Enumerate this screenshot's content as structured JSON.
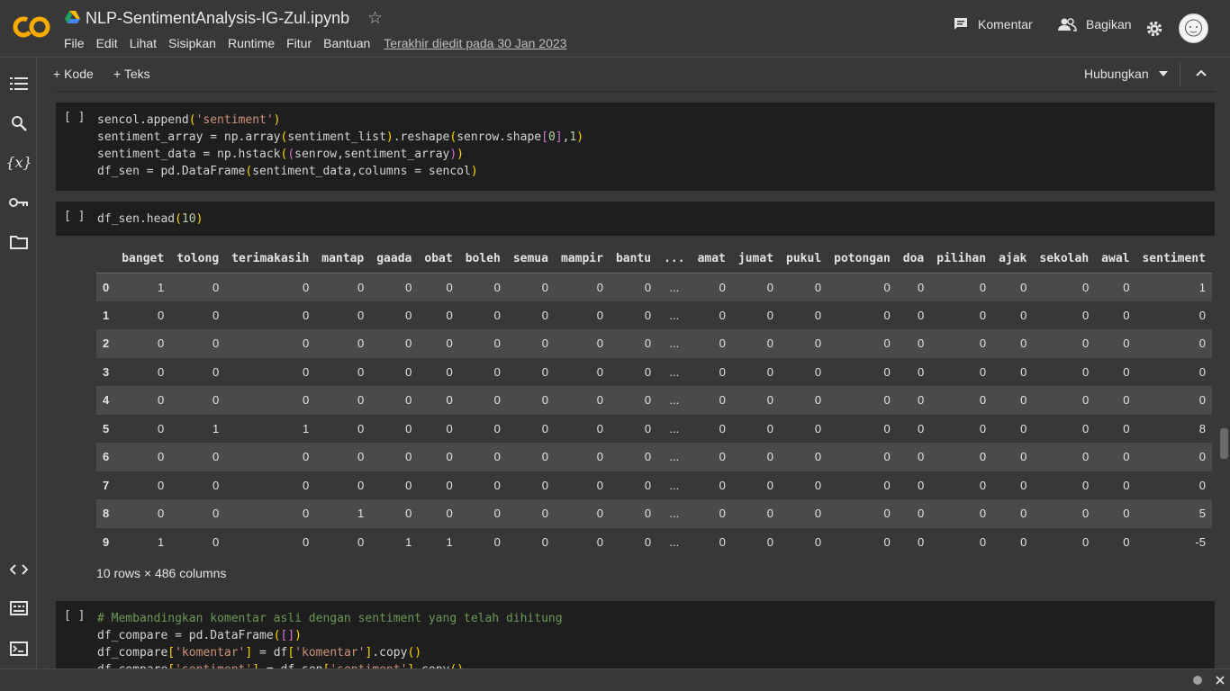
{
  "header": {
    "title": "NLP-SentimentAnalysis-IG-Zul.ipynb",
    "menu": [
      "File",
      "Edit",
      "Lihat",
      "Sisipkan",
      "Runtime",
      "Fitur",
      "Bantuan"
    ],
    "last_edit": "Terakhir diedit pada 30 Jan 2023",
    "comment_label": "Komentar",
    "share_label": "Bagikan"
  },
  "toolbar": {
    "add_code": "+ Kode",
    "add_text": "+ Teks",
    "connect": "Hubungkan"
  },
  "cells": {
    "cell1_bracket": "[ ]",
    "cell2_bracket": "[ ]",
    "cell3_bracket": "[ ]",
    "cell2_code": "df_sen.head(10)"
  },
  "dataframe": {
    "columns": [
      "",
      "banget",
      "tolong",
      "terimakasih",
      "mantap",
      "gaada",
      "obat",
      "boleh",
      "semua",
      "mampir",
      "bantu",
      "...",
      "amat",
      "jumat",
      "pukul",
      "potongan",
      "doa",
      "pilihan",
      "ajak",
      "sekolah",
      "awal",
      "sentiment"
    ],
    "rows": [
      [
        "0",
        "1",
        "0",
        "0",
        "0",
        "0",
        "0",
        "0",
        "0",
        "0",
        "0",
        "...",
        "0",
        "0",
        "0",
        "0",
        "0",
        "0",
        "0",
        "0",
        "0",
        "1"
      ],
      [
        "1",
        "0",
        "0",
        "0",
        "0",
        "0",
        "0",
        "0",
        "0",
        "0",
        "0",
        "...",
        "0",
        "0",
        "0",
        "0",
        "0",
        "0",
        "0",
        "0",
        "0",
        "0"
      ],
      [
        "2",
        "0",
        "0",
        "0",
        "0",
        "0",
        "0",
        "0",
        "0",
        "0",
        "0",
        "...",
        "0",
        "0",
        "0",
        "0",
        "0",
        "0",
        "0",
        "0",
        "0",
        "0"
      ],
      [
        "3",
        "0",
        "0",
        "0",
        "0",
        "0",
        "0",
        "0",
        "0",
        "0",
        "0",
        "...",
        "0",
        "0",
        "0",
        "0",
        "0",
        "0",
        "0",
        "0",
        "0",
        "0"
      ],
      [
        "4",
        "0",
        "0",
        "0",
        "0",
        "0",
        "0",
        "0",
        "0",
        "0",
        "0",
        "...",
        "0",
        "0",
        "0",
        "0",
        "0",
        "0",
        "0",
        "0",
        "0",
        "0"
      ],
      [
        "5",
        "0",
        "1",
        "1",
        "0",
        "0",
        "0",
        "0",
        "0",
        "0",
        "0",
        "...",
        "0",
        "0",
        "0",
        "0",
        "0",
        "0",
        "0",
        "0",
        "0",
        "8"
      ],
      [
        "6",
        "0",
        "0",
        "0",
        "0",
        "0",
        "0",
        "0",
        "0",
        "0",
        "0",
        "...",
        "0",
        "0",
        "0",
        "0",
        "0",
        "0",
        "0",
        "0",
        "0",
        "0"
      ],
      [
        "7",
        "0",
        "0",
        "0",
        "0",
        "0",
        "0",
        "0",
        "0",
        "0",
        "0",
        "...",
        "0",
        "0",
        "0",
        "0",
        "0",
        "0",
        "0",
        "0",
        "0",
        "0"
      ],
      [
        "8",
        "0",
        "0",
        "0",
        "1",
        "0",
        "0",
        "0",
        "0",
        "0",
        "0",
        "...",
        "0",
        "0",
        "0",
        "0",
        "0",
        "0",
        "0",
        "0",
        "0",
        "5"
      ],
      [
        "9",
        "1",
        "0",
        "0",
        "0",
        "1",
        "1",
        "0",
        "0",
        "0",
        "0",
        "...",
        "0",
        "0",
        "0",
        "0",
        "0",
        "0",
        "0",
        "0",
        "0",
        "-5"
      ]
    ],
    "shape_text": "10 rows × 486 columns"
  },
  "colors": {
    "accent_orange": "#f9ab00",
    "bg": "#383838",
    "cell_bg": "#1e1e1e"
  }
}
